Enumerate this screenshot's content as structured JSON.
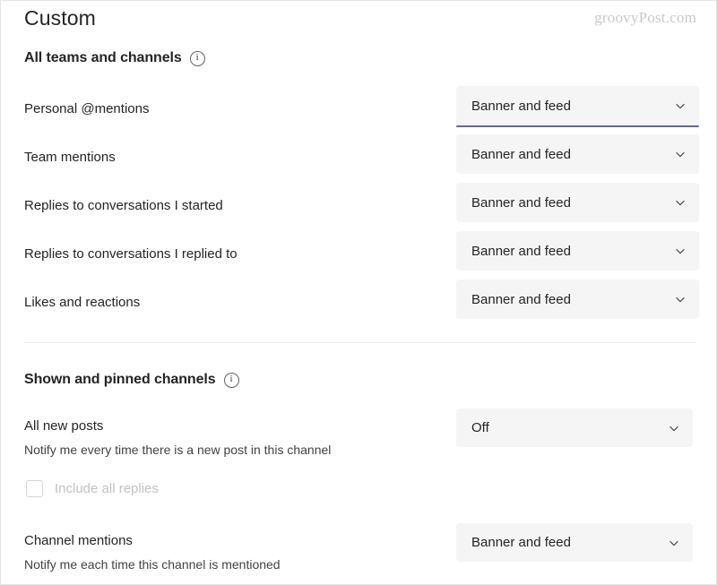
{
  "watermark": "groovyPost.com",
  "page_title": "Custom",
  "sections": [
    {
      "heading": "All teams and channels",
      "info_icon": "info-icon",
      "rows": [
        {
          "label": "Personal @mentions",
          "value": "Banner and feed",
          "focused": true
        },
        {
          "label": "Team mentions",
          "value": "Banner and feed",
          "focused": false
        },
        {
          "label": "Replies to conversations I started",
          "value": "Banner and feed",
          "focused": false
        },
        {
          "label": "Replies to conversations I replied to",
          "value": "Banner and feed",
          "focused": false
        },
        {
          "label": "Likes and reactions",
          "value": "Banner and feed",
          "focused": false
        }
      ]
    },
    {
      "heading": "Shown and pinned channels",
      "info_icon": "info-icon",
      "rows": [
        {
          "label": "All new posts",
          "description": "Notify me every time there is a new post in this channel",
          "value": "Off",
          "focused": false
        },
        {
          "label": "Channel mentions",
          "description": "Notify me each time this channel is mentioned",
          "value": "Banner and feed",
          "focused": false
        }
      ],
      "checkbox": {
        "label": "Include all replies",
        "checked": false,
        "disabled": true
      }
    }
  ],
  "icons": {
    "chevron": "chevron-down-icon"
  },
  "colors": {
    "focus_underline": "#6264a7",
    "dropdown_bg": "#f5f5f5",
    "text": "#242424"
  }
}
